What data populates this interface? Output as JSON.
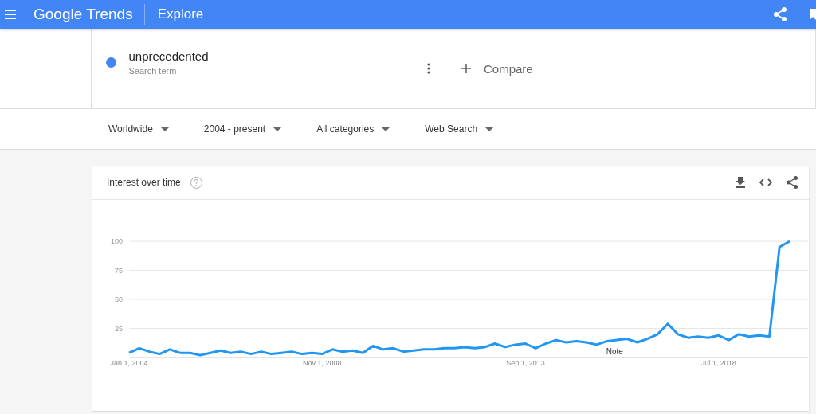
{
  "header": {
    "logo": "Google Trends",
    "title": "Explore"
  },
  "search_terms": [
    {
      "term": "unprecedented",
      "subtitle": "Search term",
      "color": "#4285f4"
    }
  ],
  "compare": {
    "label": "Compare"
  },
  "filters": [
    {
      "label": "Worldwide"
    },
    {
      "label": "2004 - present"
    },
    {
      "label": "All categories"
    },
    {
      "label": "Web Search"
    }
  ],
  "interest_card": {
    "title": "Interest over time",
    "help": "?",
    "chart_data": {
      "type": "line",
      "categories": [
        "Jan 1, 2004",
        null,
        null,
        null,
        null,
        null,
        null,
        null,
        null,
        null,
        null,
        null,
        null,
        null,
        null,
        null,
        null,
        null,
        null,
        "Nov 1, 2008",
        null,
        null,
        null,
        null,
        null,
        null,
        null,
        null,
        null,
        null,
        null,
        null,
        null,
        null,
        null,
        null,
        null,
        null,
        null,
        "Sep 1, 2013",
        null,
        null,
        null,
        null,
        null,
        null,
        null,
        null,
        null,
        null,
        null,
        null,
        null,
        null,
        null,
        null,
        null,
        null,
        "Jul 1, 2018",
        null,
        null,
        null,
        null,
        null,
        null,
        null
      ],
      "series": [
        {
          "color": "#2196f3",
          "values": [
            4,
            8,
            5,
            3,
            7,
            4,
            4,
            2,
            4,
            6,
            4,
            5,
            3,
            5,
            3,
            4,
            5,
            3,
            4,
            3,
            7,
            5,
            6,
            4,
            10,
            7,
            8,
            5,
            6,
            7,
            7,
            8,
            8,
            9,
            8,
            9,
            12,
            9,
            11,
            12,
            8,
            12,
            15,
            13,
            14,
            13,
            11,
            14,
            15,
            16,
            13,
            16,
            20,
            29,
            20,
            17,
            18,
            17,
            19,
            15,
            20,
            18,
            19,
            18,
            95,
            100
          ]
        }
      ],
      "ylim": [
        0,
        100
      ],
      "yticks": [
        25,
        50,
        75,
        100
      ],
      "grid": true,
      "annotations": [
        "Note"
      ]
    }
  }
}
